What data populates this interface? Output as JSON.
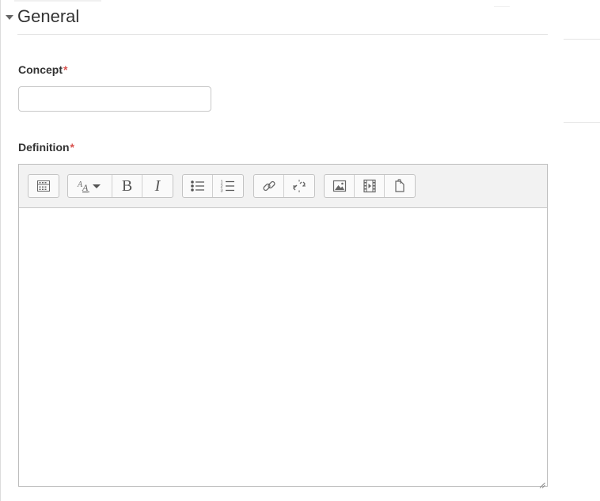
{
  "section": {
    "title": "General"
  },
  "concept": {
    "label": "Concept",
    "required_mark": "*",
    "value": ""
  },
  "definition": {
    "label": "Definition",
    "required_mark": "*",
    "value": ""
  },
  "toolbar": {
    "bold_label": "B",
    "italic_label": "I",
    "buttons": [
      {
        "icon": "toolbar-toggle-icon"
      },
      {
        "icon": "paragraph-styles-icon"
      },
      {
        "icon": "bold-icon"
      },
      {
        "icon": "italic-icon"
      },
      {
        "icon": "unordered-list-icon"
      },
      {
        "icon": "ordered-list-icon"
      },
      {
        "icon": "link-icon"
      },
      {
        "icon": "unlink-icon"
      },
      {
        "icon": "insert-image-icon"
      },
      {
        "icon": "insert-media-icon"
      },
      {
        "icon": "manage-files-icon"
      }
    ]
  },
  "colors": {
    "required": "#d9534f",
    "toolbar_bg": "#f2f2f2",
    "border": "#bdbdbd"
  }
}
